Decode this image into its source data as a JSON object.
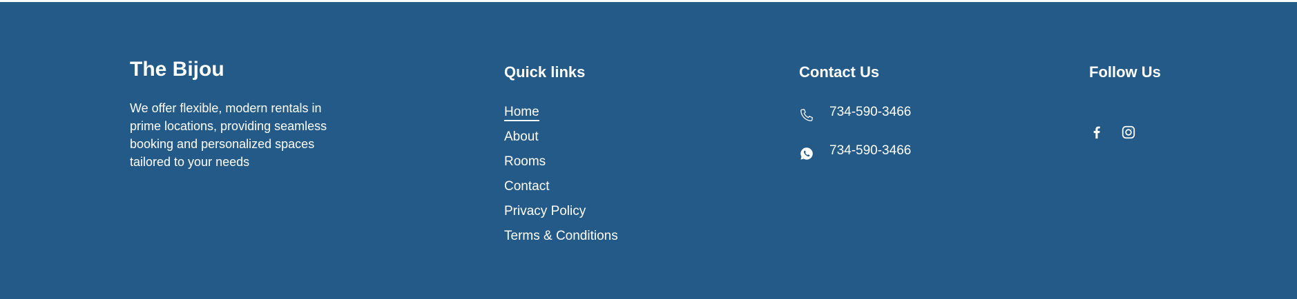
{
  "brand": {
    "title": "The Bijou",
    "description": "We offer flexible, modern rentals in prime locations, providing seamless booking and personalized spaces tailored to your needs"
  },
  "quick_links": {
    "heading": "Quick links",
    "items": [
      {
        "label": "Home",
        "active": true
      },
      {
        "label": "About"
      },
      {
        "label": "Rooms"
      },
      {
        "label": "Contact"
      },
      {
        "label": "Privacy Policy"
      },
      {
        "label": "Terms & Conditions"
      }
    ]
  },
  "contact": {
    "heading": "Contact Us",
    "phone": {
      "icon": "phone-icon",
      "value": "734-590-3466"
    },
    "whatsapp": {
      "icon": "whatsapp-icon",
      "value": "734-590-3466"
    }
  },
  "follow": {
    "heading": "Follow Us",
    "icons": [
      "facebook-icon",
      "instagram-icon"
    ]
  },
  "colors": {
    "footer_bg": "#235a87",
    "text": "#ffffff"
  }
}
